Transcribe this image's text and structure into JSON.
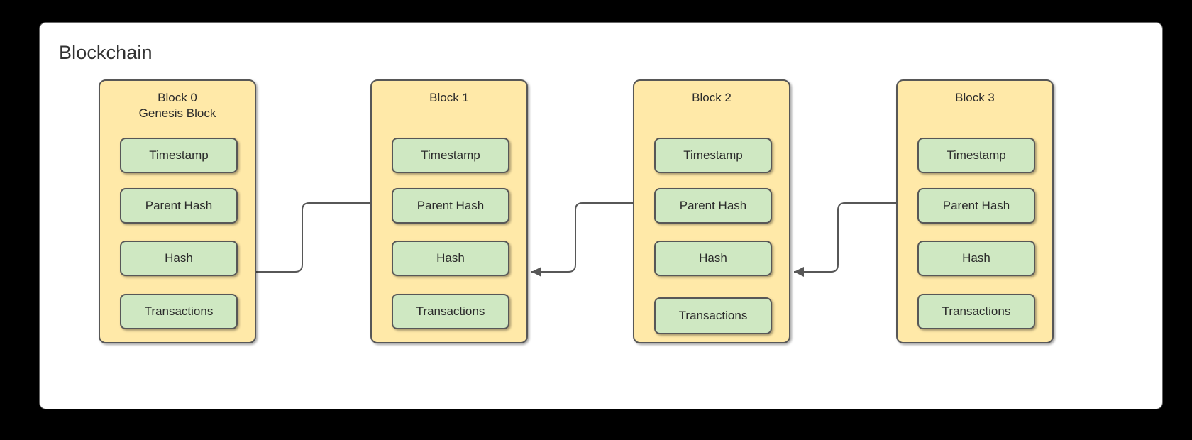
{
  "diagram": {
    "title": "Blockchain",
    "background_color": "#000000",
    "card_color": "#ffffff",
    "block_fill": "#ffe9a8",
    "field_fill": "#cfe8c2",
    "stroke_color": "#575757"
  },
  "blocks": [
    {
      "id": "block-0",
      "title": "Block 0\nGenesis Block",
      "fields": [
        {
          "label": "Timestamp"
        },
        {
          "label": "Parent Hash"
        },
        {
          "label": "Hash"
        },
        {
          "label": "Transactions"
        }
      ]
    },
    {
      "id": "block-1",
      "title": "Block 1",
      "fields": [
        {
          "label": "Timestamp"
        },
        {
          "label": "Parent Hash"
        },
        {
          "label": "Hash"
        },
        {
          "label": "Transactions"
        }
      ]
    },
    {
      "id": "block-2",
      "title": "Block 2",
      "fields": [
        {
          "label": "Timestamp"
        },
        {
          "label": "Parent Hash"
        },
        {
          "label": "Hash"
        },
        {
          "label": "Transactions"
        }
      ]
    },
    {
      "id": "block-3",
      "title": "Block 3",
      "fields": [
        {
          "label": "Timestamp"
        },
        {
          "label": "Parent Hash"
        },
        {
          "label": "Hash"
        },
        {
          "label": "Transactions"
        }
      ]
    }
  ],
  "connectors": [
    {
      "id": "connector-1-to-0",
      "from": "block-1.Parent Hash",
      "to": "block-0.Hash",
      "arrow": "left"
    },
    {
      "id": "connector-2-to-1",
      "from": "block-2.Parent Hash",
      "to": "block-1.Hash",
      "arrow": "left"
    },
    {
      "id": "connector-3-to-2",
      "from": "block-3.Parent Hash",
      "to": "block-2.Hash",
      "arrow": "left"
    }
  ]
}
